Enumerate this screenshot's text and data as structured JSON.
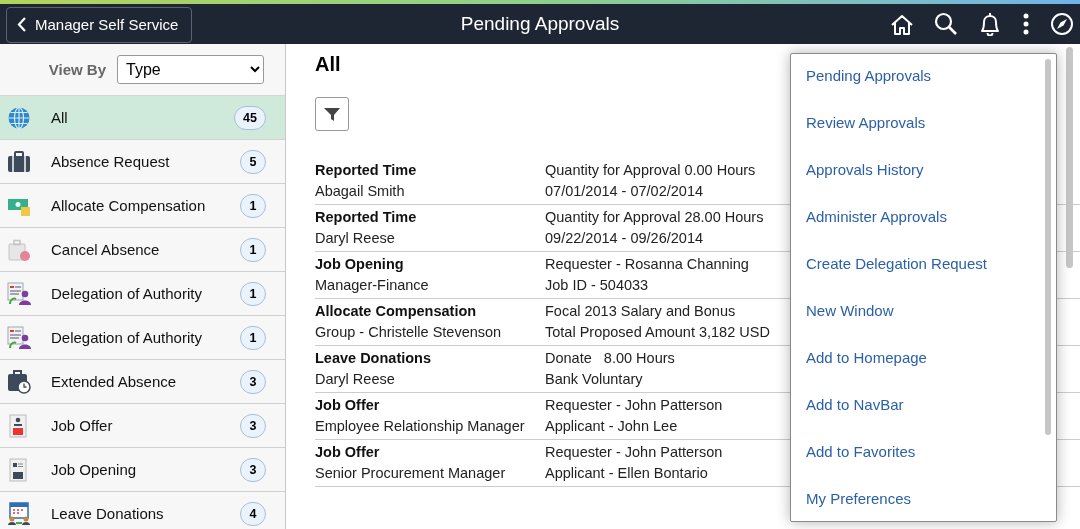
{
  "header": {
    "back_button": "Manager Self Service",
    "title": "Pending Approvals"
  },
  "sidebar": {
    "view_by": {
      "label": "View By",
      "value": "Type"
    },
    "items": [
      {
        "label": "All",
        "count": "45",
        "selected": true
      },
      {
        "label": "Absence Request",
        "count": "5",
        "selected": false
      },
      {
        "label": "Allocate Compensation",
        "count": "1",
        "selected": false
      },
      {
        "label": "Cancel Absence",
        "count": "1",
        "selected": false
      },
      {
        "label": "Delegation of Authority",
        "count": "1",
        "selected": false
      },
      {
        "label": "Delegation of Authority",
        "count": "1",
        "selected": false
      },
      {
        "label": "Extended Absence",
        "count": "3",
        "selected": false
      },
      {
        "label": "Job Offer",
        "count": "3",
        "selected": false
      },
      {
        "label": "Job Opening",
        "count": "3",
        "selected": false
      },
      {
        "label": "Leave Donations",
        "count": "4",
        "selected": false
      }
    ]
  },
  "main": {
    "heading": "All",
    "rows": [
      {
        "title": "Reported Time",
        "subtitle": "Abagail Smith",
        "detail_1": "Quantity for Approval 0.00 Hours",
        "detail_2": "07/01/2014 - 07/02/2014"
      },
      {
        "title": "Reported Time",
        "subtitle": "Daryl Reese",
        "detail_1": "Quantity for Approval 28.00 Hours",
        "detail_2": "09/22/2014 - 09/26/2014"
      },
      {
        "title": "Job Opening",
        "subtitle": "Manager-Finance",
        "detail_1": "Requester - Rosanna Channing",
        "detail_2": "Job ID - 504033"
      },
      {
        "title": "Allocate Compensation",
        "subtitle": "Group - Christelle Stevenson",
        "detail_1": "Focal 2013 Salary and Bonus",
        "detail_2": "Total Proposed Amount 3,182 USD"
      },
      {
        "title": "Leave Donations",
        "subtitle": "Daryl Reese",
        "detail_1": "Donate   8.00 Hours",
        "detail_2": "Bank Voluntary"
      },
      {
        "title": "Job Offer",
        "subtitle": "Employee Relationship Manager",
        "detail_1": "Requester - John Patterson",
        "detail_2": "Applicant - John Lee"
      },
      {
        "title": "Job Offer",
        "subtitle": "Senior Procurement Manager",
        "detail_1": "Requester - John Patterson",
        "detail_2": "Applicant - Ellen Bontario"
      }
    ]
  },
  "actions_menu": {
    "items": [
      "Pending Approvals",
      "Review Approvals",
      "Approvals History",
      "Administer Approvals",
      "Create Delegation Request",
      "New Window",
      "Add to Homepage",
      "Add to NavBar",
      "Add to Favorites",
      "My Preferences"
    ]
  }
}
